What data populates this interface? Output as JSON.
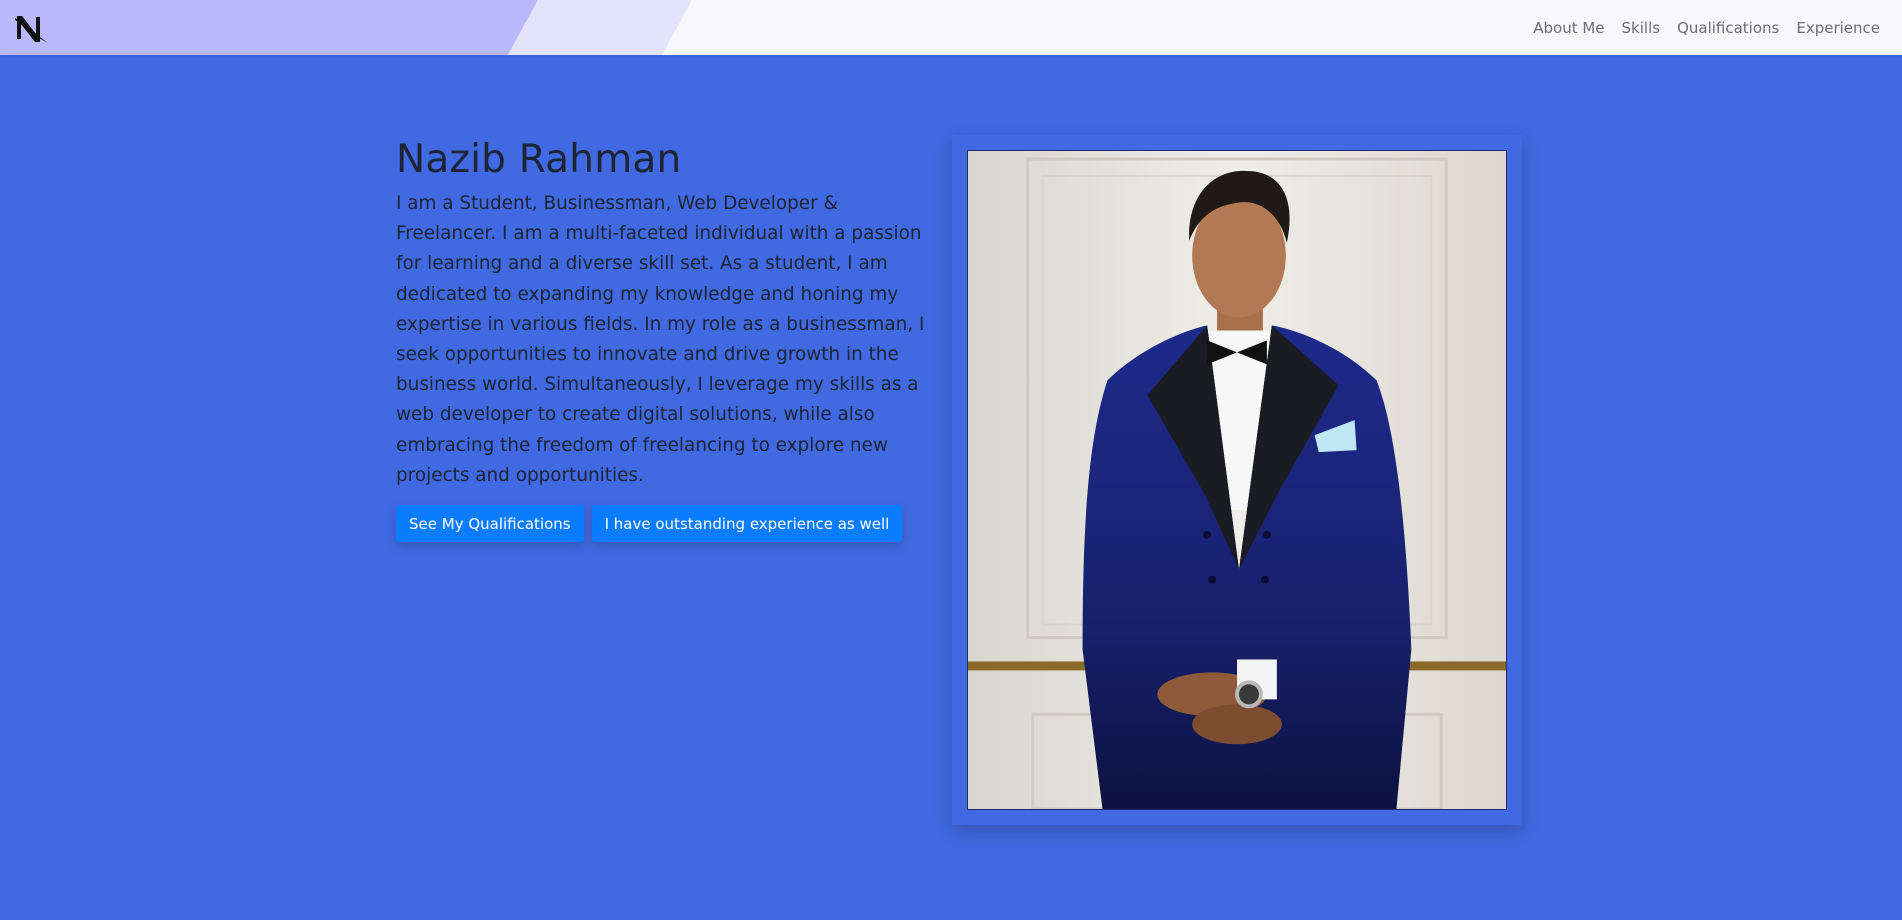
{
  "nav": {
    "logo_icon": "n-monogram-logo",
    "links": [
      "About Me",
      "Skills",
      "Qualifications",
      "Experience"
    ],
    "stripe_colors": [
      "#b9b8fb",
      "#e3e3fe",
      "#f8f8fc"
    ]
  },
  "hero": {
    "name": "Nazib Rahman",
    "bio": "I am a Student, Businessman, Web Developer & Freelancer. I am a multi-faceted individual with a passion for learning and a diverse skill set. As a student, I am dedicated to expanding my knowledge and honing my expertise in various fields. In my role as a businessman, I seek opportunities to innovate and drive growth in the business world. Simultaneously, I leverage my skills as a web developer to create digital solutions, while also embracing the freedom of freelancing to explore new projects and opportunities.",
    "buttons": {
      "qualifications": "See My Qualifications",
      "experience": "I have outstanding experience as well"
    }
  },
  "photo": {
    "alt": "Portrait photo"
  },
  "colors": {
    "background": "#4169e1",
    "button": "#0a7cff",
    "text": "#1d2433",
    "nav_link": "#6c6c74"
  }
}
